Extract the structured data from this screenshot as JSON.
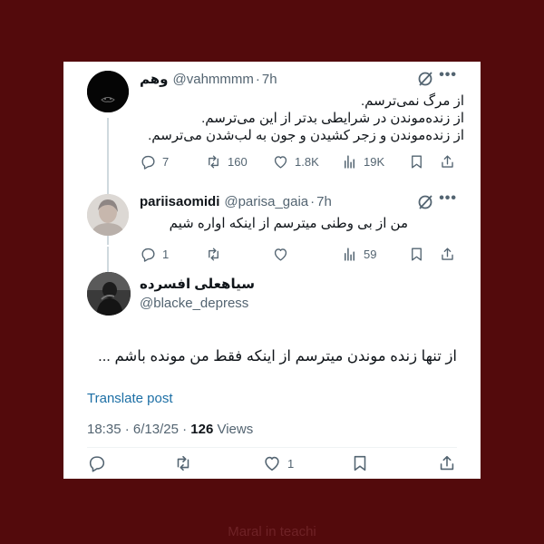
{
  "thread": [
    {
      "name": "وهم",
      "handle": "@vahmmmm",
      "time": "7h",
      "lines": [
        "از مرگ نمی‌ترسم.",
        "از زنده‌موندن در شرایطی بدتر از این می‌ترسم.",
        "از زنده‌موندن و زجر کشیدن و جون به لب‌شدن می‌ترسم."
      ],
      "replies": "7",
      "reposts": "160",
      "likes": "1.8K",
      "views": "19K"
    },
    {
      "name": "pariisaomidi",
      "handle": "@parisa_gaia",
      "time": "7h",
      "lines": [
        "من از بی وطنی میترسم از اینکه اواره شیم"
      ],
      "replies": "1",
      "views": "59"
    }
  ],
  "main_tweet": {
    "name": "سیاهعلی افسرده",
    "handle": "@blacke_depress",
    "text": "از تنها زنده موندن میترسم از اینکه فقط من مونده باشم ...",
    "translate_label": "Translate post",
    "time": "18:35",
    "date": "6/13/25",
    "views_count": "126",
    "views_label": "Views",
    "likes": "1"
  },
  "watermark": "Maral in teachi",
  "colors": {
    "background": "#530a0c",
    "card": "#ffffff",
    "link": "#1d6fa5",
    "muted": "#536471"
  }
}
